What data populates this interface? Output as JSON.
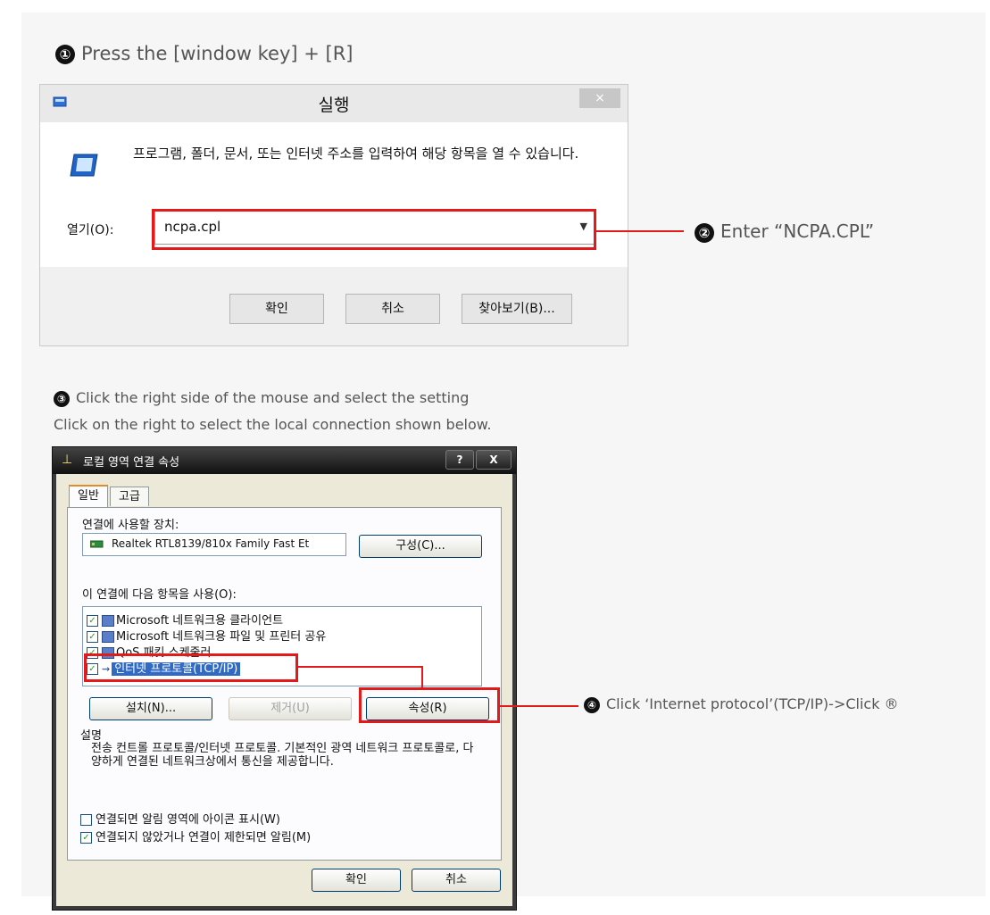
{
  "step1": {
    "badge": "①",
    "text": "Press the [window key] + [R]"
  },
  "step2": {
    "badge": "②",
    "text": "Enter “NCPA.CPL”"
  },
  "step3": {
    "badge": "③",
    "line1": "Click the right side of the mouse and select the setting",
    "line2": "Click on the right to select the local connection shown below."
  },
  "step4": {
    "badge": "④",
    "text": "Click ‘Internet protocol’(TCP/IP)->Click ®"
  },
  "run_dialog": {
    "title": "실행",
    "close": "×",
    "description": "프로그램, 폴더, 문서, 또는 인터넷 주소를 입력하여 해당 항목을 열 수 있습니다.",
    "open_label": "열기(O):",
    "input_value": "ncpa.cpl",
    "ok": "확인",
    "cancel": "취소",
    "browse": "찾아보기(B)..."
  },
  "props_dialog": {
    "title": "로컬 영역 연결 속성",
    "help_btn": "?",
    "close_btn": "X",
    "tabs": [
      "일반",
      "고급"
    ],
    "connect_using_label": "연결에 사용할 장치:",
    "device": "Realtek RTL8139/810x Family Fast Et",
    "configure": "구성(C)...",
    "items_label": "이 연결에 다음 항목을 사용(O):",
    "items": [
      "Microsoft 네트워크용 클라이언트",
      "Microsoft 네트워크용 파일 및 프린터 공유",
      "QoS 패킷 스케줄러",
      "인터넷 프로토콜(TCP/IP)"
    ],
    "install": "설치(N)...",
    "uninstall": "제거(U)",
    "properties": "속성(R)",
    "description_label": "설명",
    "description": "전송 컨트롤 프로토콜/인터넷 프로토콜. 기본적인 광역 네트워크 프로토콜로, 다양하게 연결된 네트워크상에서 통신을 제공합니다.",
    "checkbox1": "연결되면 알림 영역에 아이콘 표시(W)",
    "checkbox2": "연결되지 않았거나 연결이 제한되면 알림(M)",
    "ok": "확인",
    "cancel": "취소"
  },
  "colors": {
    "highlight": "#e21a1a",
    "selection": "#316ac5"
  }
}
